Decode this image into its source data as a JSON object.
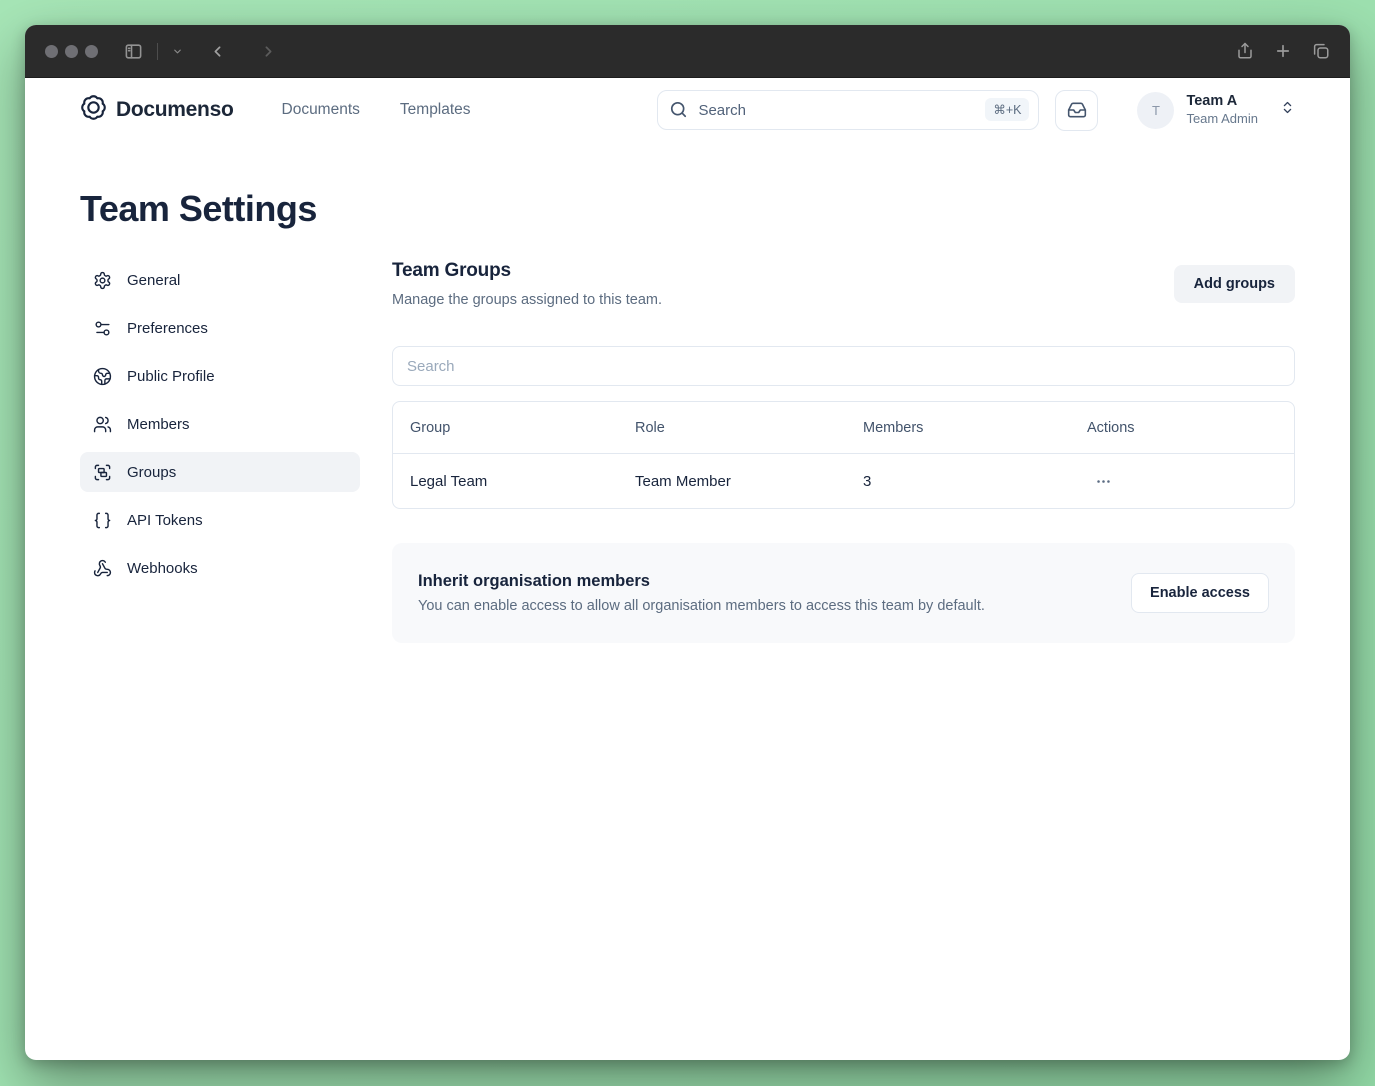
{
  "header": {
    "brand": "Documenso",
    "nav": [
      {
        "label": "Documents"
      },
      {
        "label": "Templates"
      }
    ],
    "search": {
      "placeholder": "Search",
      "shortcut": "⌘+K"
    },
    "user": {
      "initial": "T",
      "team_name": "Team A",
      "role": "Team Admin"
    }
  },
  "page": {
    "title": "Team Settings"
  },
  "sidebar": {
    "items": [
      {
        "label": "General",
        "icon": "gear-icon",
        "active": false
      },
      {
        "label": "Preferences",
        "icon": "sliders-icon",
        "active": false
      },
      {
        "label": "Public Profile",
        "icon": "globe-icon",
        "active": false
      },
      {
        "label": "Members",
        "icon": "users-icon",
        "active": false
      },
      {
        "label": "Groups",
        "icon": "group-icon",
        "active": true
      },
      {
        "label": "API Tokens",
        "icon": "braces-icon",
        "active": false
      },
      {
        "label": "Webhooks",
        "icon": "webhook-icon",
        "active": false
      }
    ]
  },
  "main": {
    "section_title": "Team Groups",
    "section_subtitle": "Manage the groups assigned to this team.",
    "add_groups_label": "Add groups",
    "search_placeholder": "Search",
    "table": {
      "columns": [
        "Group",
        "Role",
        "Members",
        "Actions"
      ],
      "rows": [
        {
          "group": "Legal Team",
          "role": "Team Member",
          "members": "3"
        }
      ]
    },
    "inherit": {
      "title": "Inherit organisation members",
      "description": "You can enable access to allow all organisation members to access this team by default.",
      "button_label": "Enable access"
    }
  },
  "colors": {
    "accent_text": "#18243c",
    "muted_text": "#5c6c80",
    "border": "#e2e8f0",
    "selected_bg": "#f1f3f6",
    "card_bg": "#f8f9fb",
    "desktop_bg": "#9de0af",
    "titlebar_bg": "#2b2b2b"
  }
}
